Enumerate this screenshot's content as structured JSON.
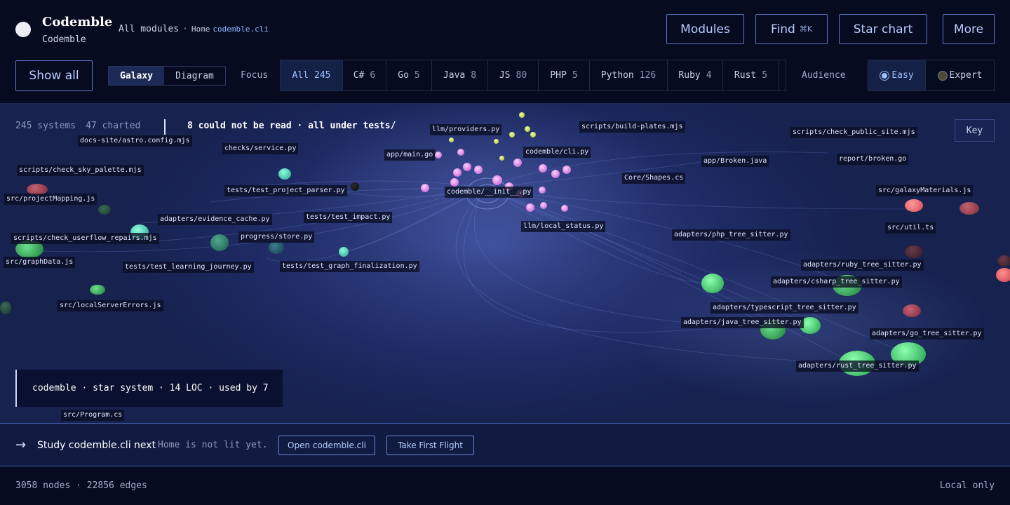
{
  "header": {
    "brand_title": "Codemble",
    "brand_sub": "Codemble",
    "crumbs": {
      "all_modules": "All modules",
      "sep": "·",
      "home": "Home",
      "current": "codemble.cli"
    },
    "buttons": {
      "modules": "Modules",
      "find": "Find",
      "find_kbd": "⌘K",
      "star_chart": "Star chart",
      "more": "More"
    }
  },
  "toolbar": {
    "show_all": "Show all",
    "view_options": [
      "Galaxy",
      "Diagram"
    ],
    "view_selected": "Galaxy",
    "focus_label": "Focus",
    "focus_tabs": [
      {
        "label": "All",
        "count": "245",
        "active": true
      },
      {
        "label": "C#",
        "count": "6"
      },
      {
        "label": "Go",
        "count": "5"
      },
      {
        "label": "Java",
        "count": "8"
      },
      {
        "label": "JS",
        "count": "80"
      },
      {
        "label": "PHP",
        "count": "5"
      },
      {
        "label": "Python",
        "count": "126"
      },
      {
        "label": "Ruby",
        "count": "4"
      },
      {
        "label": "Rust",
        "count": "5"
      }
    ],
    "audience_label": "Audience",
    "audience_options": [
      "Easy",
      "Expert"
    ],
    "audience_selected": "Easy"
  },
  "galaxy": {
    "systems": "245 systems",
    "charted": "47 charted",
    "unread": "8 could not be read · all under tests/",
    "key_button": "Key",
    "labels": [
      "llm/providers.py",
      "scripts/build-plates.mjs",
      "scripts/check_public_site.mjs",
      "docs-site/astro.config.mjs",
      "checks/service.py",
      "app/main.go",
      "codemble/cli.py",
      "app/Broken.java",
      "report/broken.go",
      "scripts/check_sky_palette.mjs",
      "Core/Shapes.cs",
      "codemble/__init__.py",
      "tests/test_project_parser.py",
      "src/galaxyMaterials.js",
      "src/projectMapping.js",
      "tests/test_impact.py",
      "adapters/evidence_cache.py",
      "llm/local_status.py",
      "src/util.ts",
      "scripts/check_userflow_repairs.mjs",
      "progress/store.py",
      "adapters/php_tree_sitter.py",
      "src/graphData.js",
      "tests/test_learning_journey.py",
      "tests/test_graph_finalization.py",
      "adapters/ruby_tree_sitter.py",
      "adapters/csharp_tree_sitter.py",
      "src/localServerErrors.js",
      "adapters/typescript_tree_sitter.py",
      "adapters/java_tree_sitter.py",
      "adapters/go_tree_sitter.py",
      "adapters/rust_tree_sitter.py",
      "src/Program.cs"
    ],
    "info": "codemble · star system · 14 LOC · used by 7"
  },
  "next": {
    "arrow": "→",
    "title": "Study codemble.cli next",
    "note": "Home is not lit yet.",
    "open_button": "Open codemble.cli",
    "flight_button": "Take First Flight"
  },
  "footer": {
    "stats": "3058 nodes · 22856 edges",
    "mode": "Local only"
  }
}
